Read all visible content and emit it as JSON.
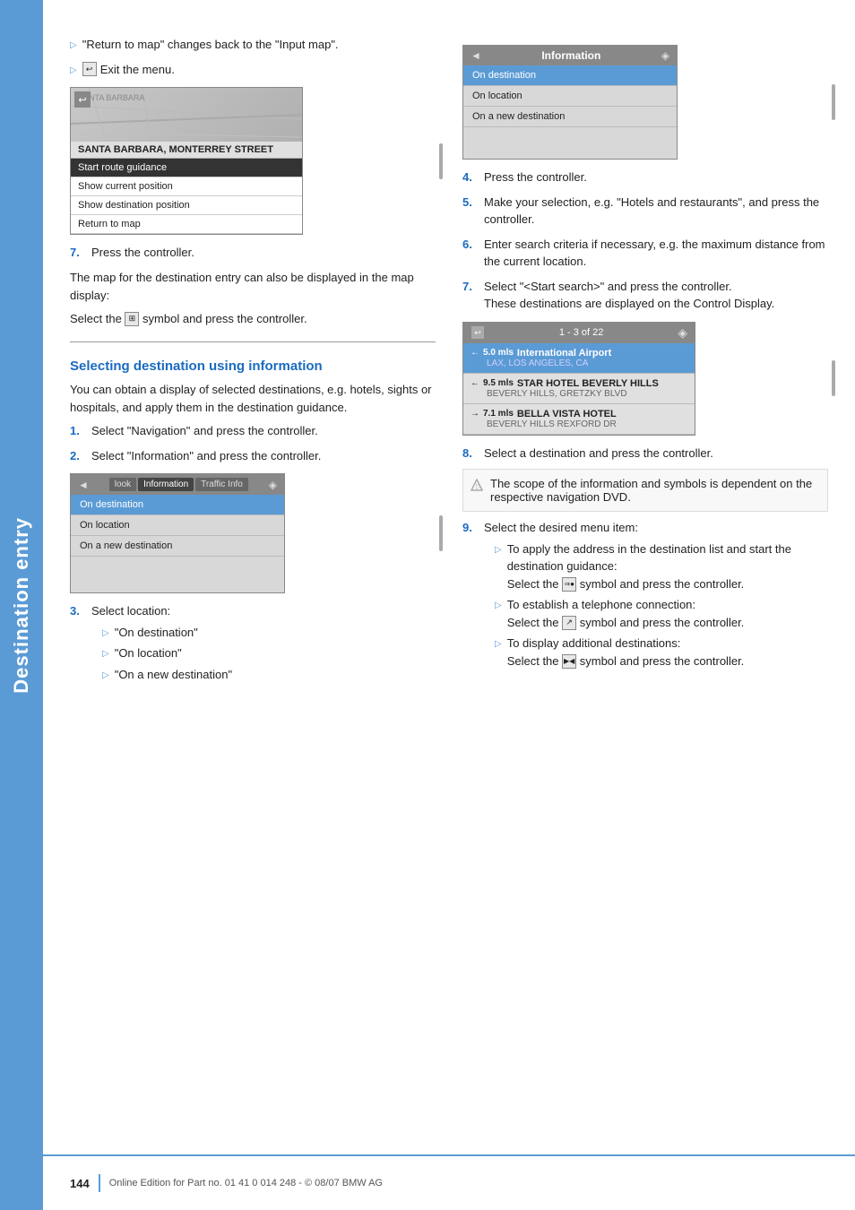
{
  "sidebar": {
    "title": "Destination entry"
  },
  "footer": {
    "page_number": "144",
    "text": "Online Edition for Part no. 01 41 0 014 248 - © 08/07 BMW AG"
  },
  "left_col": {
    "bullet1": "\"Return to map\" changes back to the \"Input map\".",
    "bullet2": "Exit the menu.",
    "nav_screen": {
      "street": "SANTA BARBARA, MONTERREY STREET",
      "menu_items": [
        {
          "label": "Start route guidance",
          "selected": true
        },
        {
          "label": "Show current position"
        },
        {
          "label": "Show destination position"
        },
        {
          "label": "Return to map"
        }
      ]
    },
    "step7_label": "7.",
    "step7_text": "Press the controller.",
    "para1": "The map for the destination entry can also be displayed in the map display:",
    "para2": "Select the symbol and press the controller.",
    "section_heading": "Selecting destination using information",
    "section_para": "You can obtain a display of selected destinations, e.g. hotels, sights or hospitals, and apply them in the destination guidance.",
    "step1_label": "1.",
    "step1_text": "Select \"Navigation\" and press the controller.",
    "step2_label": "2.",
    "step2_text": "Select \"Information\" and press the controller.",
    "info_screen": {
      "tabs": [
        "look",
        "Information",
        "Traffic Info"
      ],
      "menu_items": [
        {
          "label": "On destination"
        },
        {
          "label": "On location"
        },
        {
          "label": "On a new destination"
        }
      ]
    },
    "step3_label": "3.",
    "step3_text": "Select location:",
    "sub1": "\"On destination\"",
    "sub2": "\"On location\"",
    "sub3": "\"On a new destination\""
  },
  "right_col": {
    "info_screen2": {
      "header": "Information",
      "menu_items": [
        {
          "label": "On destination",
          "selected": true
        },
        {
          "label": "On location"
        },
        {
          "label": "On a new destination"
        }
      ]
    },
    "step4_label": "4.",
    "step4_text": "Press the controller.",
    "step5_label": "5.",
    "step5_text": "Make your selection, e.g. \"Hotels and restaurants\", and press the controller.",
    "step6_label": "6.",
    "step6_text": "Enter search criteria if necessary, e.g. the maximum distance from the current location.",
    "step7_label": "7.",
    "step7_text": "Select \"<Start search>\" and press the controller.",
    "step7_para": "These destinations are displayed on the Control Display.",
    "results_screen": {
      "header": "1 - 3 of 22",
      "items": [
        {
          "arrow": "← 5.0 mls",
          "name": "International Airport",
          "sub": "LAX, LOS ANGELES, CA",
          "selected": true
        },
        {
          "arrow": "← 9.5 mls",
          "name": "STAR HOTEL BEVERLY HILLS",
          "sub": "BEVERLY HILLS, GRETZKY BLVD"
        },
        {
          "arrow": "→ 7.1 mls",
          "name": "BELLA VISTA HOTEL",
          "sub": "BEVERLY HILLS REXFORD DR"
        }
      ]
    },
    "step8_label": "8.",
    "step8_text": "Select a destination and press the controller.",
    "info_note": "The scope of the information and symbols is dependent on the respective navigation DVD.",
    "step9_label": "9.",
    "step9_text": "Select the desired menu item:",
    "sub_a_intro": "To apply the address in the destination list and start the destination guidance:",
    "sub_a_text": "Select the symbol and press the controller.",
    "sub_b_intro": "To establish a telephone connection:",
    "sub_b_text": "Select the symbol and press the controller.",
    "sub_c_intro": "To display additional destinations:",
    "sub_c_text": "Select the symbol and press the controller."
  }
}
